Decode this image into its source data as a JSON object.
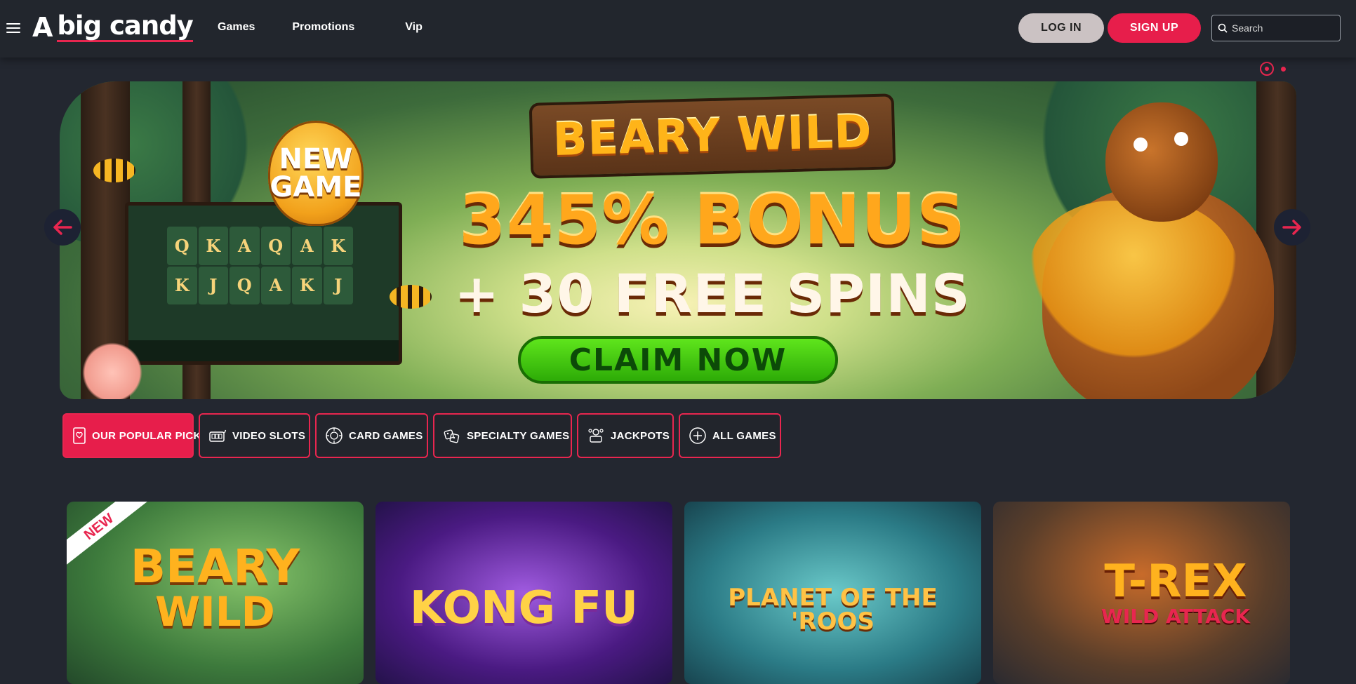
{
  "header": {
    "logo_mark": "A",
    "logo_text": "big candy",
    "nav": [
      {
        "label": "Games"
      },
      {
        "label": "Promotions"
      },
      {
        "label": "Vip"
      }
    ],
    "login_label": "LOG IN",
    "signup_label": "SIGN UP",
    "search_placeholder": "Search"
  },
  "banner": {
    "sign_title": "BEARY WILD",
    "new_game_line1": "NEW",
    "new_game_line2": "GAME",
    "bonus_line1": "345% BONUS",
    "bonus_line2": "+ 30 FREE SPINS",
    "cta_label": "CLAIM NOW",
    "slot_symbols": [
      "Q",
      "K",
      "A",
      "Q",
      "A",
      "K",
      "K",
      "J",
      "Q",
      "A",
      "K",
      "J"
    ],
    "slides_total": 2,
    "active_slide": 1
  },
  "tabs": [
    {
      "label": "OUR POPULAR PICKS",
      "icon": "popular-icon",
      "active": true
    },
    {
      "label": "VIDEO SLOTS",
      "icon": "slots-icon",
      "active": false
    },
    {
      "label": "CARD GAMES",
      "icon": "card-games-icon",
      "active": false
    },
    {
      "label": "SPECIALTY GAMES",
      "icon": "specialty-icon",
      "active": false
    },
    {
      "label": "JACKPOTS",
      "icon": "jackpot-icon",
      "active": false
    },
    {
      "label": "ALL GAMES",
      "icon": "plus-circle-icon",
      "active": false
    }
  ],
  "games": [
    {
      "title_line1": "BEARY",
      "title_line2": "WILD",
      "badge": "NEW"
    },
    {
      "title_line1": "KONG FU",
      "title_line2": ""
    },
    {
      "title_line1": "PLANET OF THE 'ROOS",
      "title_line2": ""
    },
    {
      "title_line1": "T-REX",
      "title_line2": "WILD ATTACK"
    }
  ],
  "colors": {
    "accent": "#e71e4b",
    "header_bg": "#22262d",
    "page_bg": "#232730",
    "login_bg": "#cbc2c3",
    "cta_green": "#2dab07"
  }
}
